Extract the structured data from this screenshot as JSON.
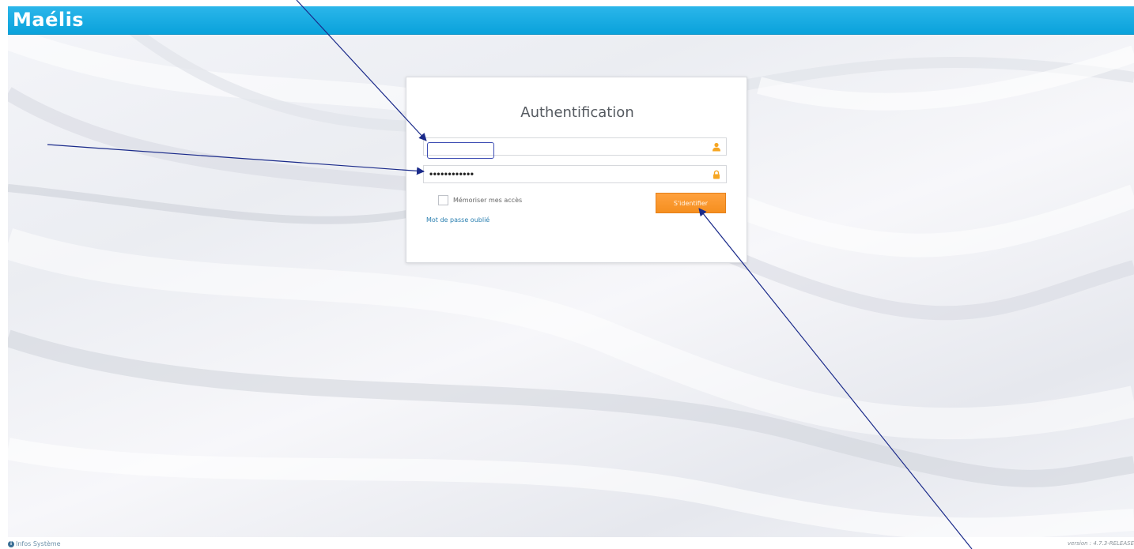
{
  "app": {
    "logo_text": "Maélis",
    "brand_color": "#12a7df"
  },
  "login": {
    "title": "Authentification",
    "username": {
      "value": "",
      "icon": "user-icon"
    },
    "password": {
      "value": "************",
      "masked_display": "••••••••••••",
      "icon": "lock-icon"
    },
    "remember_label": "Mémoriser mes accès",
    "remember_checked": false,
    "submit_label": "S'identifier",
    "submit_color": "#f7941d",
    "forgot_label": "Mot de passe oublié"
  },
  "footer": {
    "info_icon": "info-icon",
    "info_label": "Infos Système",
    "version_text": "version : 4.7.3-RELEASE"
  },
  "annotation": {
    "arrow_color": "#1a2a8a"
  }
}
